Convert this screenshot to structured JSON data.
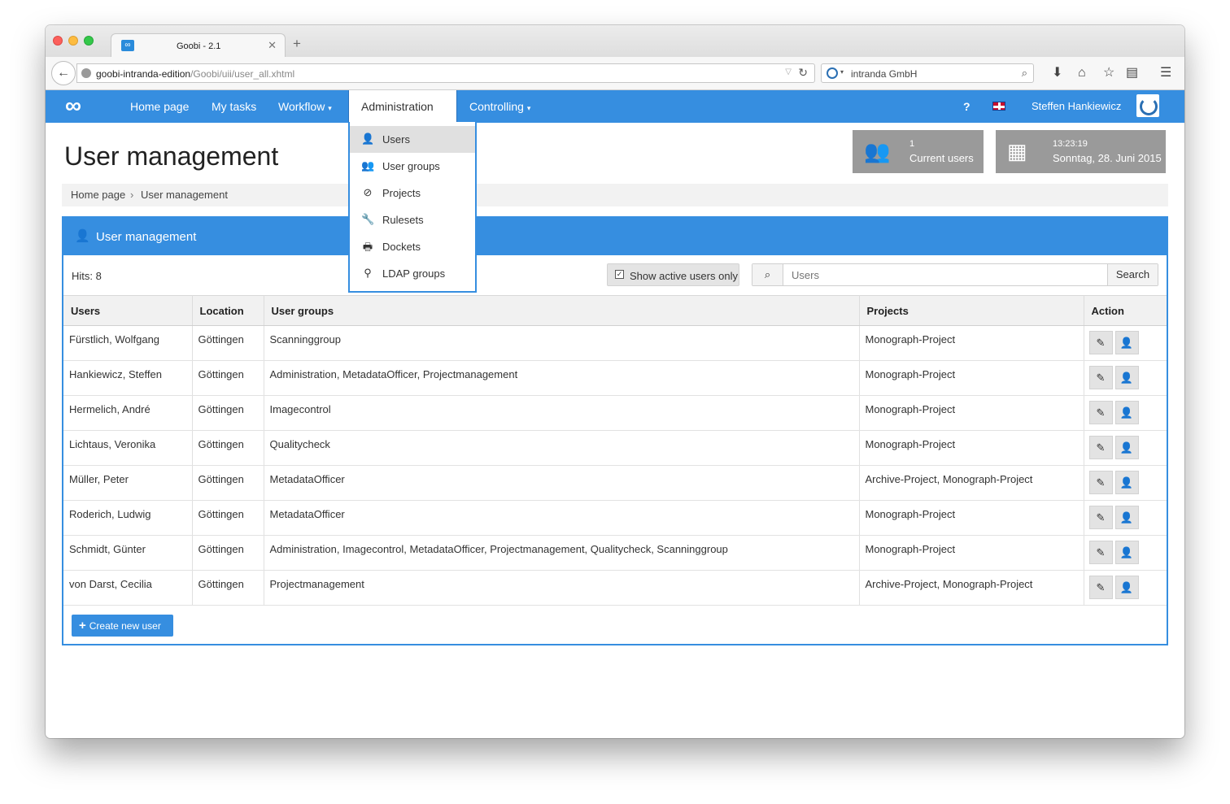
{
  "browser": {
    "tab_title": "Goobi - 2.1",
    "tab_favicon": "∞",
    "url_domain": "goobi-intranda-edition",
    "url_path": "/Goobi/uii/user_all.xhtml",
    "search_engine_text": "intranda GmbH"
  },
  "app": {
    "brand_color": "#368ee0",
    "logo_icon": "∞",
    "menu": {
      "home": "Home page",
      "tasks": "My tasks",
      "workflow": "Workflow",
      "administration": "Administration",
      "controlling": "Controlling"
    },
    "help": "?",
    "user_name": "Steffen Hankiewicz"
  },
  "admin_menu": [
    {
      "label": "Users",
      "icon": "user-icon",
      "glyph": "👤",
      "active": true
    },
    {
      "label": "User groups",
      "icon": "users-icon",
      "glyph": "👥",
      "active": false
    },
    {
      "label": "Projects",
      "icon": "compass-icon",
      "glyph": "⊘",
      "active": false
    },
    {
      "label": "Rulesets",
      "icon": "wrench-icon",
      "glyph": "🔧",
      "active": false
    },
    {
      "label": "Dockets",
      "icon": "print-icon",
      "glyph": "🖶",
      "active": false
    },
    {
      "label": "LDAP groups",
      "icon": "ldap-icon",
      "glyph": "⚲",
      "active": false
    }
  ],
  "page": {
    "title": "User management",
    "breadcrumb": {
      "home": "Home page",
      "sep": "›",
      "current": "User management"
    }
  },
  "infobox": {
    "users_count": "1",
    "users_label": "Current users",
    "time": "13:23:19",
    "date": "Sonntag, 28. Juni 2015"
  },
  "panel": {
    "title": "User management",
    "hits": "Hits: 8",
    "active_only_label": "Show active users only",
    "active_only_checked": true,
    "search_placeholder": "Users",
    "search_button": "Search",
    "create_label": "Create new user"
  },
  "table": {
    "headers": [
      "Users",
      "Location",
      "User groups",
      "Projects",
      "Action"
    ],
    "rows": [
      {
        "user": "Fürstlich, Wolfgang",
        "location": "Göttingen",
        "groups": "Scanninggroup",
        "projects": "Monograph-Project"
      },
      {
        "user": "Hankiewicz, Steffen",
        "location": "Göttingen",
        "groups": "Administration, MetadataOfficer, Projectmanagement",
        "projects": "Monograph-Project"
      },
      {
        "user": "Hermelich, André",
        "location": "Göttingen",
        "groups": "Imagecontrol",
        "projects": "Monograph-Project"
      },
      {
        "user": "Lichtaus, Veronika",
        "location": "Göttingen",
        "groups": "Qualitycheck",
        "projects": "Monograph-Project"
      },
      {
        "user": "Müller, Peter",
        "location": "Göttingen",
        "groups": "MetadataOfficer",
        "projects": "Archive-Project, Monograph-Project"
      },
      {
        "user": "Roderich, Ludwig",
        "location": "Göttingen",
        "groups": "MetadataOfficer",
        "projects": "Monograph-Project"
      },
      {
        "user": "Schmidt, Günter",
        "location": "Göttingen",
        "groups": "Administration, Imagecontrol, MetadataOfficer, Projectmanagement, Qualitycheck, Scanninggroup",
        "projects": "Monograph-Project"
      },
      {
        "user": "von Darst, Cecilia",
        "location": "Göttingen",
        "groups": "Projectmanagement",
        "projects": "Archive-Project, Monograph-Project"
      }
    ]
  }
}
